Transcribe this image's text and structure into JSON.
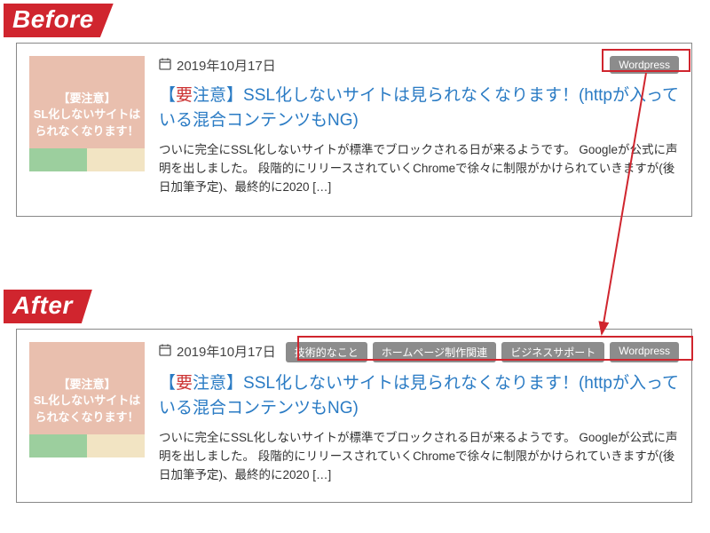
{
  "labels": {
    "before": "Before",
    "after": "After"
  },
  "post": {
    "date": "2019年10月17日",
    "title_prefix": "【",
    "title_red": "要",
    "title_rest": "注意】SSL化しないサイトは見られなくなります！(httpが入っている混合コンテンツもNG)",
    "excerpt": "ついに完全にSSL化しないサイトが標準でブロックされる日が来るようです。 Googleが公式に声明を出しました。 段階的にリリースされていくChromeで徐々に制限がかけられていきますが(後日加筆予定)、最終的に2020 […]",
    "thumb": {
      "line1": "【要注意】",
      "line2": "SL化しないサイトは",
      "line3": "られなくなります！"
    }
  },
  "tags_before": [
    "Wordpress"
  ],
  "tags_after": [
    "技術的なこと",
    "ホームページ制作関連",
    "ビジネスサポート",
    "Wordpress"
  ]
}
